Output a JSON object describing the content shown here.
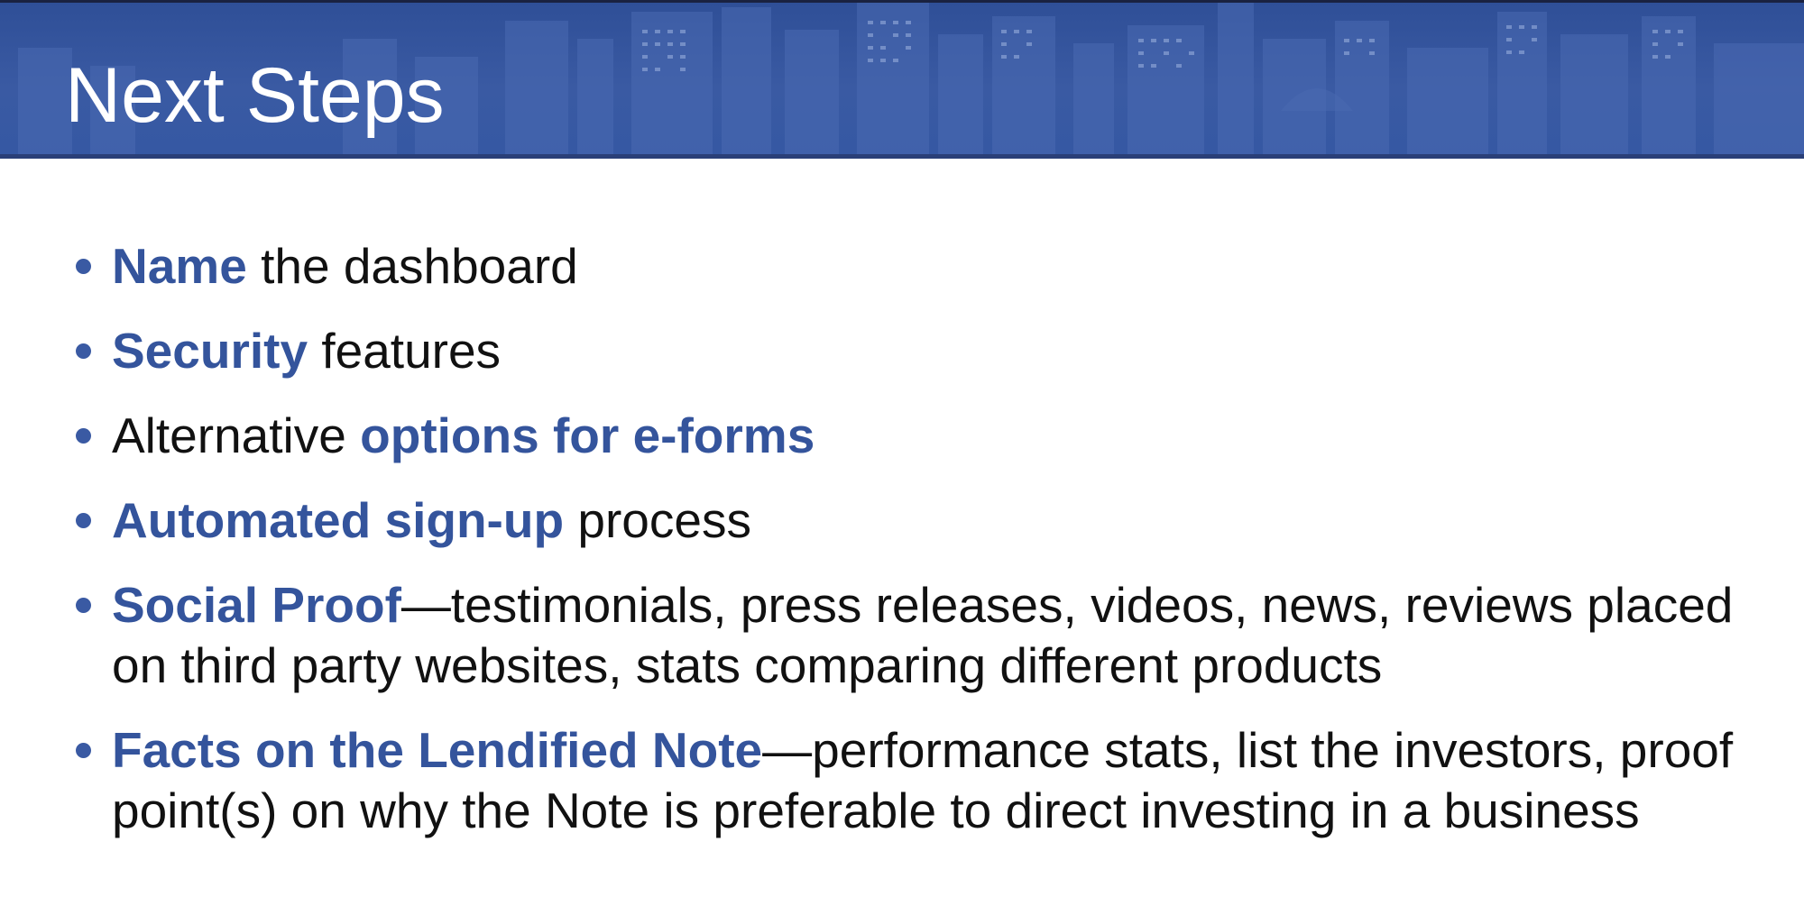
{
  "header": {
    "title": "Next Steps",
    "band_color": "#3a5aa3",
    "background_image": "city-skyline-icon"
  },
  "colors": {
    "accent": "#34549c",
    "text": "#111111",
    "bullet": "#3a5aa3"
  },
  "bullets": [
    {
      "highlight": "Name",
      "text": " the dashboard"
    },
    {
      "highlight": "Security",
      "text": " features"
    },
    {
      "prefix": "Alternative ",
      "highlight": "options for e-forms"
    },
    {
      "highlight": "Automated sign-up",
      "text": " process"
    },
    {
      "highlight": "Social Proof",
      "text": "—testimonials, press releases, videos, news, reviews placed on third party websites, stats comparing different products"
    },
    {
      "highlight": "Facts on the Lendified Note",
      "text": "—performance stats, list the investors, proof point(s) on why the Note is preferable to direct investing in a business"
    }
  ]
}
